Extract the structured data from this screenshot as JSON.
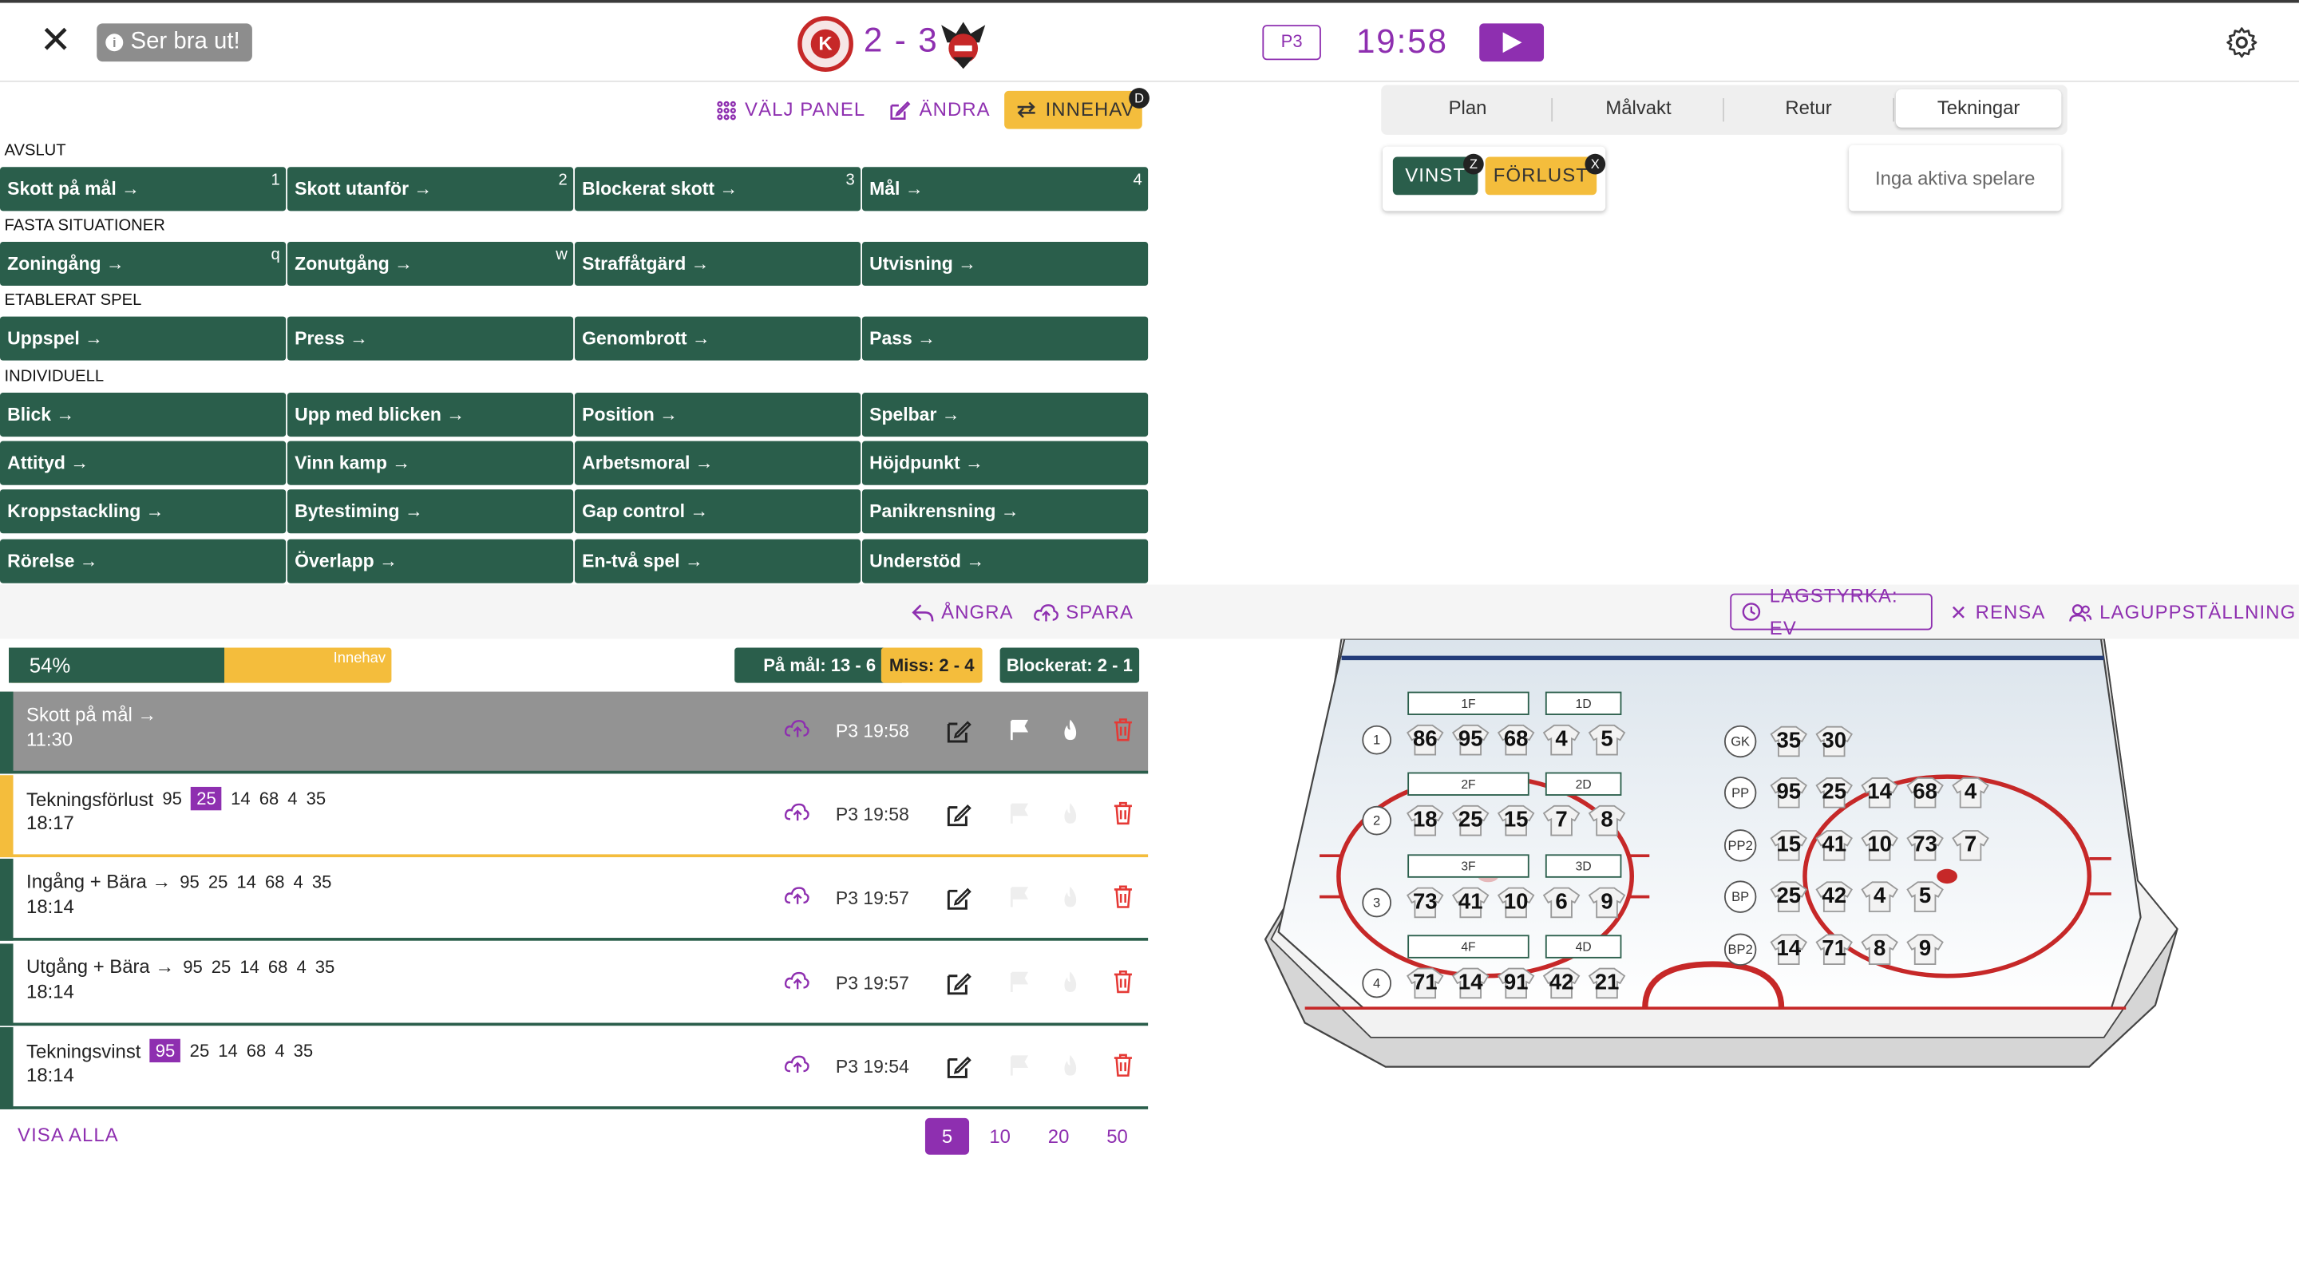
{
  "header": {
    "toast": "Ser bra ut!",
    "score": "2 - 3",
    "period": "P3",
    "clock": "19:58"
  },
  "toolbar": {
    "valj_panel": "VÄLJ PANEL",
    "andra": "ÄNDRA",
    "innehav": "INNEHAV",
    "innehav_key": "D"
  },
  "panel": {
    "sections": [
      {
        "title": "AVSLUT",
        "buttons": [
          [
            "Skott på mål →",
            "1"
          ],
          [
            "Skott utanför →",
            "2"
          ],
          [
            "Blockerat skott →",
            "3"
          ],
          [
            "Mål →",
            "4"
          ]
        ]
      },
      {
        "title": "FASTA SITUATIONER",
        "buttons": [
          [
            "Zoningång →",
            "q"
          ],
          [
            "Zonutgång →",
            "w"
          ],
          [
            "Straffåtgärd →",
            ""
          ],
          [
            "Utvisning →",
            ""
          ]
        ]
      },
      {
        "title": "ETABLERAT SPEL",
        "buttons": [
          [
            "Uppspel →",
            ""
          ],
          [
            "Press →",
            ""
          ],
          [
            "Genombrott →",
            ""
          ],
          [
            "Pass →",
            ""
          ]
        ]
      },
      {
        "title": "INDIVIDUELL",
        "buttons": [
          [
            "Blick →",
            ""
          ],
          [
            "Upp med blicken →",
            ""
          ],
          [
            "Position →",
            ""
          ],
          [
            "Spelbar →",
            ""
          ],
          [
            "Attityd →",
            ""
          ],
          [
            "Vinn kamp →",
            ""
          ],
          [
            "Arbetsmoral →",
            ""
          ],
          [
            "Höjdpunkt →",
            ""
          ],
          [
            "Kroppstackling →",
            ""
          ],
          [
            "Bytestiming →",
            ""
          ],
          [
            "Gap control →",
            ""
          ],
          [
            "Panikrensning →",
            ""
          ],
          [
            "Rörelse →",
            ""
          ],
          [
            "Överlapp →",
            ""
          ],
          [
            "En-två spel →",
            ""
          ],
          [
            "Understöd →",
            ""
          ]
        ]
      }
    ]
  },
  "tabs": [
    "Plan",
    "Målvakt",
    "Retur",
    "Tekningar"
  ],
  "active_tab": "Tekningar",
  "faceoff": {
    "win": "VINST",
    "win_key": "Z",
    "loss": "FÖRLUST",
    "loss_key": "X"
  },
  "active_players": "Inga aktiva spelare",
  "actions": {
    "undo": "ÅNGRA",
    "save": "SPARA",
    "strength": "LAGSTYRKA: EV",
    "clear": "RENSA",
    "lineup": "LAGUPPSTÄLLNING"
  },
  "possession": {
    "percent_label": "54%",
    "percent": 54,
    "label": "Innehav"
  },
  "stats": {
    "on_goal": "På mål: 13 - 6",
    "miss": "Miss: 2 - 4",
    "blocked": "Blockerat: 2 - 1"
  },
  "events": [
    {
      "title": "Skott på mål →",
      "players": [],
      "time": "11:30",
      "stamp": "P3 19:58",
      "selected": true,
      "accent": "#2a5e4b"
    },
    {
      "title": "Tekningsförlust",
      "players": [
        [
          "95",
          false
        ],
        [
          "25",
          true
        ],
        [
          "14",
          false
        ],
        [
          "68",
          false
        ],
        [
          "4",
          false
        ],
        [
          "35",
          false
        ]
      ],
      "time": "18:17",
      "stamp": "P3 19:58",
      "selected": false,
      "accent": "#f4bd3c"
    },
    {
      "title": "Ingång + Bära →",
      "players": [
        [
          "95",
          false
        ],
        [
          "25",
          false
        ],
        [
          "14",
          false
        ],
        [
          "68",
          false
        ],
        [
          "4",
          false
        ],
        [
          "35",
          false
        ]
      ],
      "time": "18:14",
      "stamp": "P3 19:57",
      "selected": false,
      "accent": "#2a5e4b"
    },
    {
      "title": "Utgång + Bära →",
      "players": [
        [
          "95",
          false
        ],
        [
          "25",
          false
        ],
        [
          "14",
          false
        ],
        [
          "68",
          false
        ],
        [
          "4",
          false
        ],
        [
          "35",
          false
        ]
      ],
      "time": "18:14",
      "stamp": "P3 19:57",
      "selected": false,
      "accent": "#2a5e4b"
    },
    {
      "title": "Tekningsvinst",
      "players": [
        [
          "95",
          true
        ],
        [
          "25",
          false
        ],
        [
          "14",
          false
        ],
        [
          "68",
          false
        ],
        [
          "4",
          false
        ],
        [
          "35",
          false
        ]
      ],
      "time": "18:14",
      "stamp": "P3 19:54",
      "selected": false,
      "accent": "#2a5e4b"
    }
  ],
  "pagination": {
    "show_all": "VISA ALLA",
    "sizes": [
      "5",
      "10",
      "20",
      "50"
    ],
    "active": "5"
  },
  "lineup": {
    "lines": [
      {
        "label": "1",
        "fwd": "1F",
        "def": "1D",
        "players": [
          "86",
          "95",
          "68",
          "4",
          "5"
        ]
      },
      {
        "label": "2",
        "fwd": "2F",
        "def": "2D",
        "players": [
          "18",
          "25",
          "15",
          "7",
          "8"
        ]
      },
      {
        "label": "3",
        "fwd": "3F",
        "def": "3D",
        "players": [
          "73",
          "41",
          "10",
          "6",
          "9"
        ]
      },
      {
        "label": "4",
        "fwd": "4F",
        "def": "4D",
        "players": [
          "71",
          "14",
          "91",
          "42",
          "21"
        ]
      }
    ],
    "special": [
      {
        "label": "GK",
        "players": [
          "35",
          "30"
        ]
      },
      {
        "label": "PP",
        "players": [
          "95",
          "25",
          "14",
          "68",
          "4"
        ]
      },
      {
        "label": "PP2",
        "players": [
          "15",
          "41",
          "10",
          "73",
          "7"
        ]
      },
      {
        "label": "BP",
        "players": [
          "25",
          "42",
          "4",
          "5"
        ]
      },
      {
        "label": "BP2",
        "players": [
          "14",
          "71",
          "8",
          "9"
        ]
      }
    ]
  },
  "colors": {
    "primary": "#8e2fb0",
    "green": "#2a5e4b",
    "yellow": "#f4bd3c"
  }
}
